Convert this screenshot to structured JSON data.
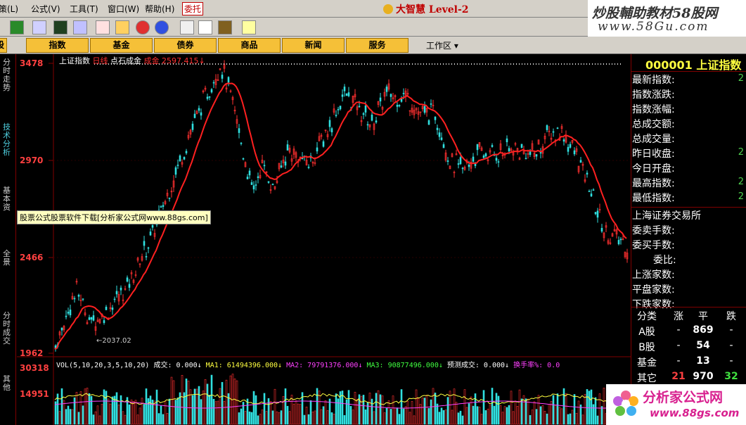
{
  "menu": [
    "策(L)",
    "公式(V)",
    "工具(T)",
    "窗口(W)",
    "帮助(H)",
    "委托"
  ],
  "app_title": "大智慧 Level-2",
  "watermark_top": {
    "line1": "炒股輔助教材58股网",
    "line2": "www.58Gu.com"
  },
  "tabs": [
    "股",
    "指数",
    "基金",
    "债券",
    "商品",
    "新闻",
    "服务"
  ],
  "workarea_label": "工作区",
  "left_tabs": [
    {
      "label": "分时走势",
      "active": false
    },
    {
      "label": "技术分析",
      "active": true
    },
    {
      "label": "基本资",
      "active": false
    },
    {
      "label": "全景",
      "active": false
    },
    {
      "label": "分时成交",
      "active": false
    },
    {
      "label": "其他",
      "active": false
    }
  ],
  "chart_header": {
    "name": "上证指数",
    "period": "日线",
    "style": "点石成金",
    "extra": "成金  2597.415↓"
  },
  "ad_banner": "股票公式股票软件下载[分析家公式网www.88gs.com]",
  "y_axis_labels": [
    "3478",
    "2970",
    "2466",
    "1962"
  ],
  "vol_axis_labels": [
    "30318",
    "14951"
  ],
  "low_label": "2037.02",
  "vol_header": {
    "vol": "VOL(5,10,20,3,5,10,20)  成交: 0.000↓",
    "ma1": "MA1: 61494396.000↓",
    "ma2": "MA2: 79791376.000↓",
    "ma3": "MA3: 90877496.000↓",
    "pred": "预测成交: 0.000↓",
    "turn": "换手率%: 0.0"
  },
  "quote_panel": {
    "code": "000001",
    "name": "上证指数",
    "rows": [
      {
        "label": "最新指数:",
        "value": "2"
      },
      {
        "label": "指数涨跌:",
        "value": ""
      },
      {
        "label": "指数涨幅:",
        "value": ""
      },
      {
        "label": "总成交额:",
        "value": ""
      },
      {
        "label": "总成交量:",
        "value": ""
      },
      {
        "label": "昨日收盘:",
        "value": "2"
      },
      {
        "label": "今日开盘:",
        "value": ""
      },
      {
        "label": "最高指数:",
        "value": "2"
      },
      {
        "label": "最低指数:",
        "value": "2"
      }
    ],
    "exchange": "上海证券交易所",
    "rows2": [
      {
        "label": "委卖手数:"
      },
      {
        "label": "委买手数:"
      },
      {
        "label": "委比:"
      },
      {
        "label": "上涨家数:"
      },
      {
        "label": "平盘家数:"
      },
      {
        "label": "下跌家数:"
      }
    ],
    "breadth_header": [
      "分类",
      "涨",
      "平",
      "跌"
    ],
    "breadth_rows": [
      {
        "cat": "A股",
        "up": "-",
        "flat": "869",
        "down": "-"
      },
      {
        "cat": "B股",
        "up": "-",
        "flat": "54",
        "down": "-"
      },
      {
        "cat": "基金",
        "up": "-",
        "flat": "13",
        "down": "-"
      },
      {
        "cat": "其它",
        "up": "21",
        "flat": "970",
        "down": "32"
      }
    ]
  },
  "watermark_bottom": {
    "line1": "分析家公式网",
    "line2": "www.88gs.com"
  },
  "colors": {
    "up": "#ff3030",
    "down": "#30e0e0",
    "ma_line": "#ff2020",
    "accent": "#ffff40"
  }
}
